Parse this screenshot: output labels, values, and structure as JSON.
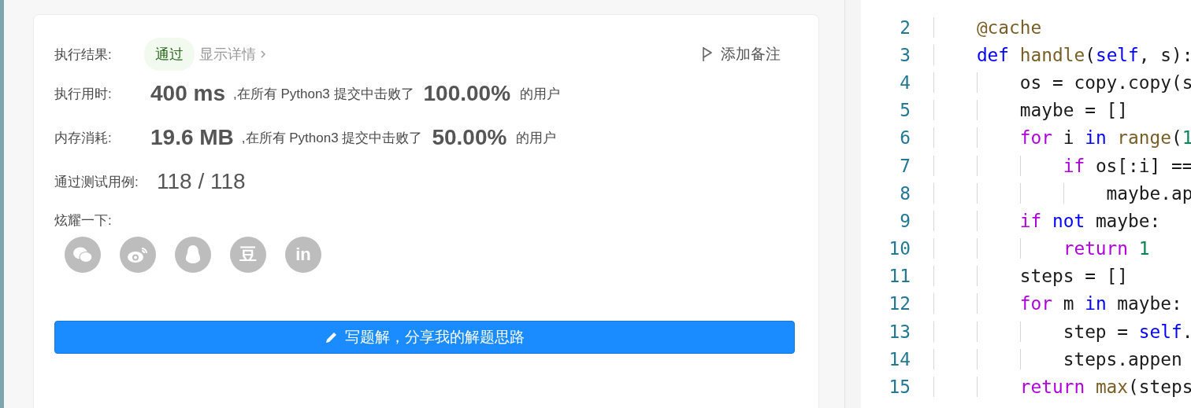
{
  "result": {
    "label": "执行结果:",
    "status": "通过",
    "details_link": "显示详情",
    "add_note": "添加备注"
  },
  "stats": [
    {
      "label": "执行用时:",
      "value": "400 ms",
      "middle": ",在所有 Python3 提交中击败了",
      "percent": "100.00%",
      "suffix": "的用户"
    },
    {
      "label": "内存消耗:",
      "value": "19.6 MB",
      "middle": ",在所有 Python3 提交中击败了",
      "percent": "50.00%",
      "suffix": "的用户"
    }
  ],
  "tests": {
    "label": "通过测试用例:",
    "value": "118 / 118"
  },
  "share": {
    "label": "炫耀一下:",
    "buttons": [
      {
        "kind": "chat"
      },
      {
        "kind": "eye"
      },
      {
        "kind": "penguin"
      },
      {
        "kind": "glyph",
        "glyph": "豆"
      },
      {
        "kind": "glyph",
        "glyph": "in"
      }
    ]
  },
  "write_button": "写题解，分享我的解题思路",
  "editor": {
    "lines": [
      {
        "number": "2",
        "tokens": [
          {
            "text": "    @cache",
            "kind": "decorator"
          }
        ]
      },
      {
        "number": "3",
        "tokens": [
          {
            "text": "    def ",
            "kind": "keyword"
          },
          {
            "text": "handle",
            "kind": "function"
          },
          {
            "text": "(",
            "kind": "plain"
          },
          {
            "text": "self",
            "kind": "keyword"
          },
          {
            "text": ", s):",
            "kind": "plain"
          }
        ]
      },
      {
        "number": "4",
        "tokens": [
          {
            "text": "        os = copy.copy(s",
            "kind": "plain"
          }
        ]
      },
      {
        "number": "5",
        "tokens": [
          {
            "text": "        maybe = []",
            "kind": "plain"
          }
        ]
      },
      {
        "number": "6",
        "tokens": [
          {
            "text": "        for",
            "kind": "control"
          },
          {
            "text": " i ",
            "kind": "plain"
          },
          {
            "text": "in ",
            "kind": "keyword"
          },
          {
            "text": "range",
            "kind": "function"
          },
          {
            "text": "(",
            "kind": "plain"
          },
          {
            "text": "1",
            "kind": "number"
          }
        ]
      },
      {
        "number": "7",
        "tokens": [
          {
            "text": "            if",
            "kind": "control"
          },
          {
            "text": " os[:i] ==",
            "kind": "plain"
          }
        ]
      },
      {
        "number": "8",
        "tokens": [
          {
            "text": "                maybe.ap",
            "kind": "plain"
          }
        ]
      },
      {
        "number": "9",
        "tokens": [
          {
            "text": "        if ",
            "kind": "control"
          },
          {
            "text": "not",
            "kind": "keyword"
          },
          {
            "text": " maybe:",
            "kind": "plain"
          }
        ]
      },
      {
        "number": "10",
        "tokens": [
          {
            "text": "            return ",
            "kind": "control"
          },
          {
            "text": "1",
            "kind": "number"
          }
        ]
      },
      {
        "number": "11",
        "tokens": [
          {
            "text": "        steps = []",
            "kind": "plain"
          }
        ]
      },
      {
        "number": "12",
        "tokens": [
          {
            "text": "        for",
            "kind": "control"
          },
          {
            "text": " m ",
            "kind": "plain"
          },
          {
            "text": "in",
            "kind": "keyword"
          },
          {
            "text": " maybe:",
            "kind": "plain"
          }
        ]
      },
      {
        "number": "13",
        "tokens": [
          {
            "text": "            step = ",
            "kind": "plain"
          },
          {
            "text": "self",
            "kind": "keyword"
          },
          {
            "text": ".",
            "kind": "plain"
          }
        ]
      },
      {
        "number": "14",
        "tokens": [
          {
            "text": "            steps.appen",
            "kind": "plain"
          }
        ]
      },
      {
        "number": "15",
        "tokens": [
          {
            "text": "        return ",
            "kind": "control"
          },
          {
            "text": "max",
            "kind": "function"
          },
          {
            "text": "(steps",
            "kind": "plain"
          }
        ]
      }
    ]
  }
}
